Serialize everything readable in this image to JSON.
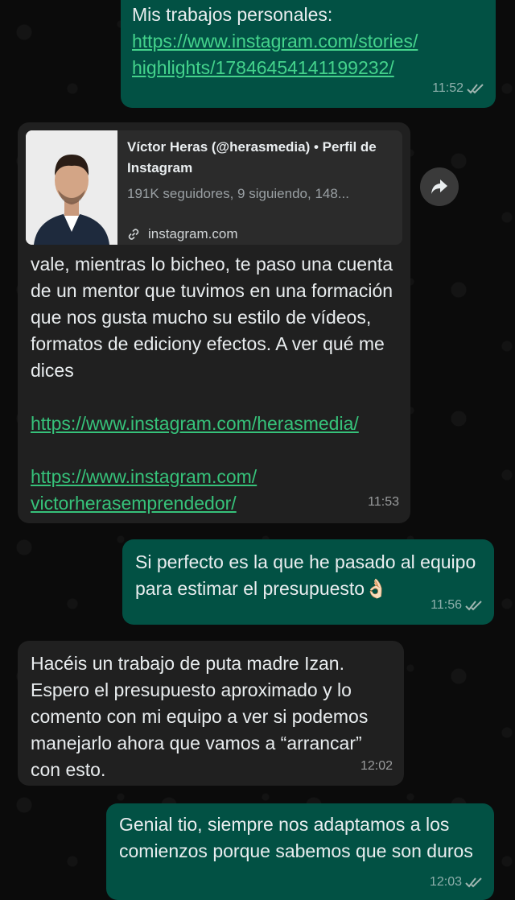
{
  "chat": {
    "messages": [
      {
        "id": "m1",
        "direction": "outgoing",
        "text": "Mis trabajos personales:",
        "link": "https://www.instagram.com/stories/highlights/17846454141199232/",
        "link_lines": [
          "https://www.instagram.com/stories/",
          "highlights/17846454141199232/"
        ],
        "time": "11:52",
        "status": "read"
      },
      {
        "id": "m2",
        "direction": "incoming",
        "preview": {
          "title": "Víctor Heras (@herasmedia) • Perfil de Instagram",
          "description": "191K seguidores, 9 siguiendo, 148...",
          "domain": "instagram.com"
        },
        "text": "vale, mientras lo bicheo, te paso una cuenta de un mentor que tuvimos en una formación que nos gusta mucho su estilo de vídeos, formatos de ediciony efectos. A ver qué me dices",
        "link1": "https://www.instagram.com/herasmedia/",
        "link2_lines": [
          "https://www.instagram.com/",
          "victorherasemprendedor/"
        ],
        "time": "11:53"
      },
      {
        "id": "m3",
        "direction": "outgoing",
        "text": "Si perfecto es la que he pasado al equipo para estimar el presupuesto👌🏻",
        "time": "11:56",
        "status": "read"
      },
      {
        "id": "m4",
        "direction": "incoming",
        "text": "Hacéis un trabajo de puta madre Izan. Espero el presupuesto aproximado y lo comento con mi equipo a ver si podemos manejarlo ahora que vamos a “arrancar” con esto.",
        "time": "12:02"
      },
      {
        "id": "m5",
        "direction": "outgoing",
        "text": "Genial tio, siempre nos adaptamos a los comienzos porque sabemos que son duros",
        "time": "12:03",
        "status": "read"
      }
    ]
  },
  "icons": {
    "read_receipt": "double-check-icon",
    "share": "share-forward-icon",
    "link": "link-icon"
  },
  "colors": {
    "outgoing_bubble": "#025144",
    "incoming_bubble": "#202020",
    "link": "#36c27a",
    "background": "#0b0b0b"
  }
}
